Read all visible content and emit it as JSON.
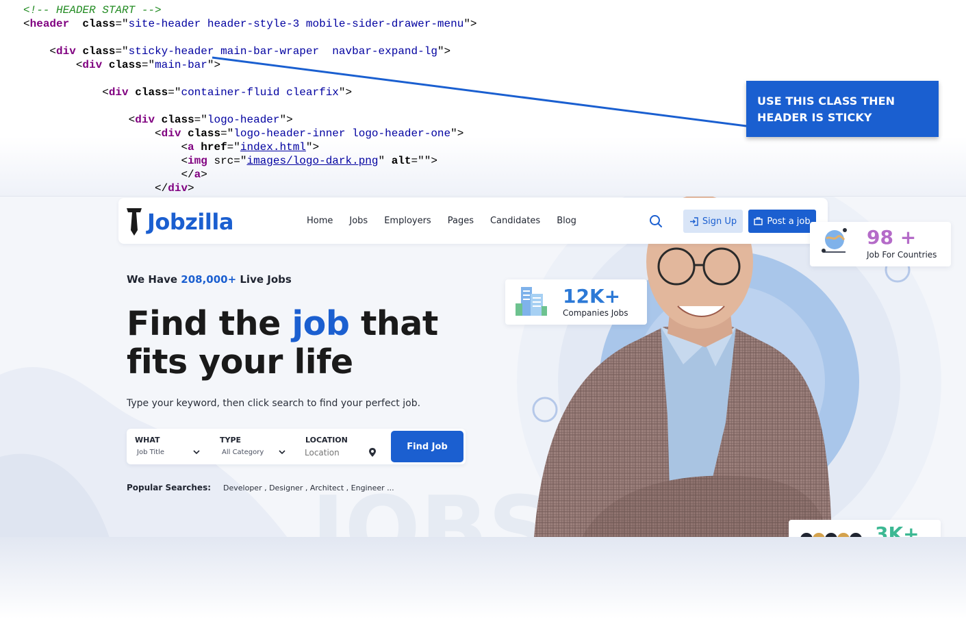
{
  "code": {
    "lines": [
      {
        "indent": "",
        "parts": [
          {
            "t": "<!-- HEADER START -->",
            "c": "cm"
          }
        ]
      },
      {
        "indent": "",
        "parts": [
          {
            "t": "<",
            "c": ""
          },
          {
            "t": "header",
            "c": "tg"
          },
          {
            "t": "  ",
            "c": ""
          },
          {
            "t": "class",
            "c": "at"
          },
          {
            "t": "=\"",
            "c": ""
          },
          {
            "t": "site-header header-style-3 mobile-sider-drawer-menu",
            "c": "vl"
          },
          {
            "t": "\">",
            "c": ""
          }
        ]
      },
      {
        "indent": "    ",
        "parts": [
          {
            "t": "<",
            "c": ""
          },
          {
            "t": "div",
            "c": "tg"
          },
          {
            "t": " ",
            "c": ""
          },
          {
            "t": "class",
            "c": "at"
          },
          {
            "t": "=\"",
            "c": ""
          },
          {
            "t": "sticky-header main-bar-wraper  navbar-expand-lg",
            "c": "vl"
          },
          {
            "t": "\">",
            "c": ""
          }
        ]
      },
      {
        "indent": "        ",
        "parts": [
          {
            "t": "<",
            "c": ""
          },
          {
            "t": "div",
            "c": "tg"
          },
          {
            "t": " ",
            "c": ""
          },
          {
            "t": "class",
            "c": "at"
          },
          {
            "t": "=\"",
            "c": ""
          },
          {
            "t": "main-bar",
            "c": "vl"
          },
          {
            "t": "\">",
            "c": ""
          }
        ]
      },
      {
        "indent": "            ",
        "parts": [
          {
            "t": "<",
            "c": ""
          },
          {
            "t": "div",
            "c": "tg"
          },
          {
            "t": " ",
            "c": ""
          },
          {
            "t": "class",
            "c": "at"
          },
          {
            "t": "=\"",
            "c": ""
          },
          {
            "t": "container-fluid clearfix",
            "c": "vl"
          },
          {
            "t": "\">",
            "c": ""
          }
        ]
      },
      {
        "indent": "                ",
        "parts": [
          {
            "t": "<",
            "c": ""
          },
          {
            "t": "div",
            "c": "tg"
          },
          {
            "t": " ",
            "c": ""
          },
          {
            "t": "class",
            "c": "at"
          },
          {
            "t": "=\"",
            "c": ""
          },
          {
            "t": "logo-header",
            "c": "vl"
          },
          {
            "t": "\">",
            "c": ""
          }
        ]
      },
      {
        "indent": "                    ",
        "parts": [
          {
            "t": "<",
            "c": ""
          },
          {
            "t": "div",
            "c": "tg"
          },
          {
            "t": " ",
            "c": ""
          },
          {
            "t": "class",
            "c": "at"
          },
          {
            "t": "=\"",
            "c": ""
          },
          {
            "t": "logo-header-inner logo-header-one",
            "c": "vl"
          },
          {
            "t": "\">",
            "c": ""
          }
        ]
      },
      {
        "indent": "                        ",
        "parts": [
          {
            "t": "<",
            "c": ""
          },
          {
            "t": "a",
            "c": "tg"
          },
          {
            "t": " ",
            "c": ""
          },
          {
            "t": "href",
            "c": "at"
          },
          {
            "t": "=\"",
            "c": ""
          },
          {
            "t": "index.html",
            "c": "ln"
          },
          {
            "t": "\">",
            "c": ""
          }
        ]
      },
      {
        "indent": "                        ",
        "parts": [
          {
            "t": "<",
            "c": ""
          },
          {
            "t": "img",
            "c": "tg"
          },
          {
            "t": " src=\"",
            "c": ""
          },
          {
            "t": "images/logo-dark.png",
            "c": "ln"
          },
          {
            "t": "\" ",
            "c": ""
          },
          {
            "t": "alt",
            "c": "at"
          },
          {
            "t": "=\"\">",
            "c": ""
          }
        ]
      },
      {
        "indent": "                        ",
        "parts": [
          {
            "t": "</",
            "c": ""
          },
          {
            "t": "a",
            "c": "tg"
          },
          {
            "t": ">",
            "c": ""
          }
        ]
      },
      {
        "indent": "                    ",
        "parts": [
          {
            "t": "</",
            "c": ""
          },
          {
            "t": "div",
            "c": "tg"
          },
          {
            "t": ">",
            "c": ""
          }
        ]
      }
    ]
  },
  "callout": {
    "text": "USE THIS CLASS THEN HEADER IS STICKY",
    "color": "#1a5fd0"
  },
  "site": {
    "brand": {
      "name": "Jobzilla",
      "color": "#1b5fd0",
      "logo_icon": "tie-icon"
    },
    "nav": [
      "Home",
      "Jobs",
      "Employers",
      "Pages",
      "Candidates",
      "Blog"
    ],
    "search_icon": "search-icon",
    "signup_label": "Sign Up",
    "post_label": "Post a job",
    "live_jobs": {
      "prefix": "We Have ",
      "count": "208,000+",
      "suffix": " Live Jobs"
    },
    "headline": {
      "part1": "Find the ",
      "highlight": "job",
      "part2": " that",
      "line2": "fits your life"
    },
    "tagline": "Type your keyword, then click search to find your perfect job.",
    "search": {
      "what_label": "WHAT",
      "what_value": "Job Title",
      "type_label": "TYPE",
      "type_value": "All Category",
      "location_label": "LOCATION",
      "location_placeholder": "Location",
      "find_label": "Find Job"
    },
    "popular": {
      "label": "Popular Searches:",
      "items": "Developer , Designer , Architect , Engineer ..."
    },
    "stats": [
      {
        "value": "12K+",
        "label": "Companies Jobs",
        "color": "#2c79d6"
      },
      {
        "value": "98 +",
        "label": "Job For Countries",
        "color": "#b46bc8"
      },
      {
        "value": "3K+",
        "label": "",
        "color": "#3cb893"
      }
    ]
  }
}
